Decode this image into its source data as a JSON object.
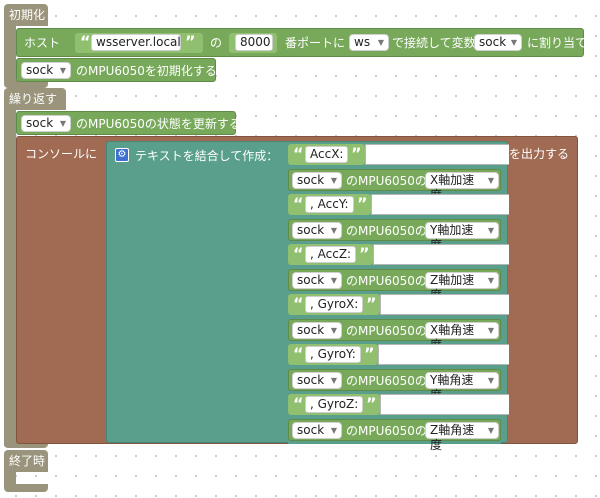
{
  "setup": {
    "label": "初期化",
    "host_label": "ホスト",
    "host_value": "wsserver.local",
    "of_label": "の",
    "port_value": "8000",
    "port_suffix": "番ポートに",
    "protocol": "ws",
    "connect_label": "で接続して変数",
    "var_name": "sock",
    "assign_label": "に割り当てる",
    "init_var": "sock",
    "init_label": "のMPU6050を初期化する"
  },
  "loop": {
    "label": "繰り返す",
    "update_var": "sock",
    "update_label": "のMPU6050の状態を更新する",
    "console_label": "コンソールに",
    "join_label": "テキストを結合して作成：",
    "output_label": "を出力する",
    "items": [
      {
        "kind": "text",
        "value": "AccX:"
      },
      {
        "kind": "sensor",
        "var": "sock",
        "of": "のMPU6050の",
        "axis": "X軸加速度"
      },
      {
        "kind": "text",
        "value": ", AccY:"
      },
      {
        "kind": "sensor",
        "var": "sock",
        "of": "のMPU6050の",
        "axis": "Y軸加速度"
      },
      {
        "kind": "text",
        "value": ", AccZ:"
      },
      {
        "kind": "sensor",
        "var": "sock",
        "of": "のMPU6050の",
        "axis": "Z軸加速度"
      },
      {
        "kind": "text",
        "value": ", GyroX:"
      },
      {
        "kind": "sensor",
        "var": "sock",
        "of": "のMPU6050の",
        "axis": "X軸角速度"
      },
      {
        "kind": "text",
        "value": ", GyroY:"
      },
      {
        "kind": "sensor",
        "var": "sock",
        "of": "のMPU6050の",
        "axis": "Y軸角速度"
      },
      {
        "kind": "text",
        "value": ", GyroZ:"
      },
      {
        "kind": "sensor",
        "var": "sock",
        "of": "のMPU6050の",
        "axis": "Z軸角速度"
      }
    ]
  },
  "finish": {
    "label": "終了時"
  },
  "glyphs": {
    "open_quote": "“",
    "close_quote": "”",
    "dropdown_arrow": "▼",
    "gear_icon": "⚙"
  },
  "colors": {
    "event": "#9a947c",
    "green": "#78a95b",
    "brown": "#a06a53",
    "teal": "#5a9f8b",
    "light_green": "#8fbf6f"
  }
}
